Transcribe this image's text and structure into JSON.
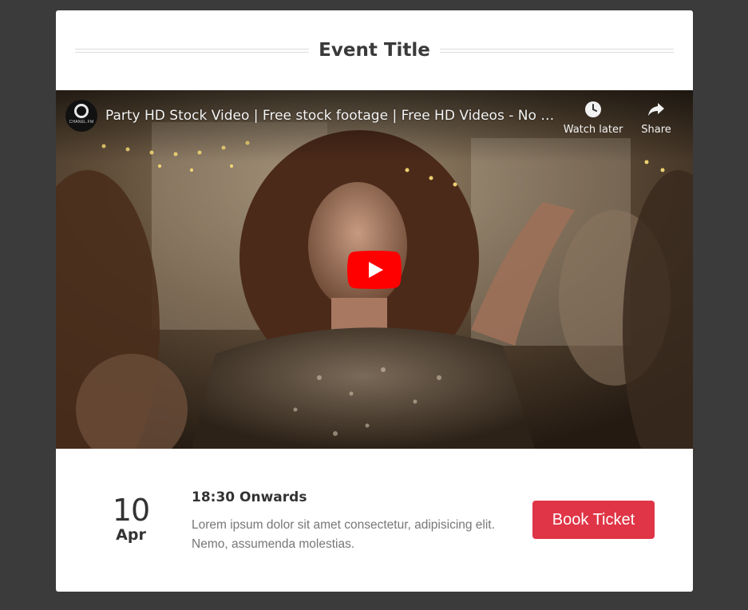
{
  "event": {
    "title": "Event Title",
    "date_day": "10",
    "date_month": "Apr",
    "time": "18:30 Onwards",
    "description": "Lorem ipsum dolor sit amet consectetur, adipisicing elit. Nemo, assumenda molestias.",
    "book_label": "Book Ticket"
  },
  "video": {
    "title": "Party HD Stock Video | Free stock footage | Free HD Videos - No Copyright",
    "channel_avatar_text": "CHANEL.FM",
    "watch_later_label": "Watch later",
    "share_label": "Share",
    "icons": {
      "play": "youtube-play-icon",
      "watch_later": "clock-icon",
      "share": "share-arrow-icon"
    }
  },
  "colors": {
    "page_background": "#3b3b3b",
    "card_background": "#ffffff",
    "accent": "#df3546",
    "youtube_red": "#ff0000"
  }
}
